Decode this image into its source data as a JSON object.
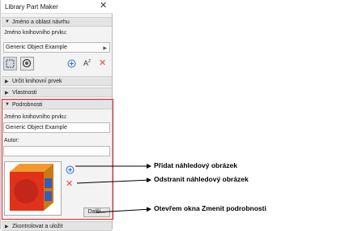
{
  "window": {
    "title": "Library Part Maker",
    "close_glyph": "✕"
  },
  "sections": {
    "name_area": "Jméno a oblast návrhu",
    "define": "Určit knihovní prvek",
    "properties": "Vlastnosti",
    "details": "Podrobnosti",
    "check_save": "Zkontrolovat a uložit"
  },
  "name_area": {
    "label": "Jméno knihovního prvku:",
    "value": "Generic Object Example"
  },
  "details": {
    "name_label": "Jméno knihovního prvku:",
    "name_value": "Generic Object Example",
    "author_label": "Autor:",
    "author_value": "",
    "more_button": "Další..."
  },
  "callouts": {
    "add": "Přidat náhledový obrázek",
    "remove": "Odstranit náhledový obrázek",
    "open": "Otevřem okna Zmenit podrobnosti"
  },
  "colors": {
    "accent_red": "#e0282d",
    "add_blue": "#2b6cd8",
    "remove_red": "#e84c2b"
  }
}
